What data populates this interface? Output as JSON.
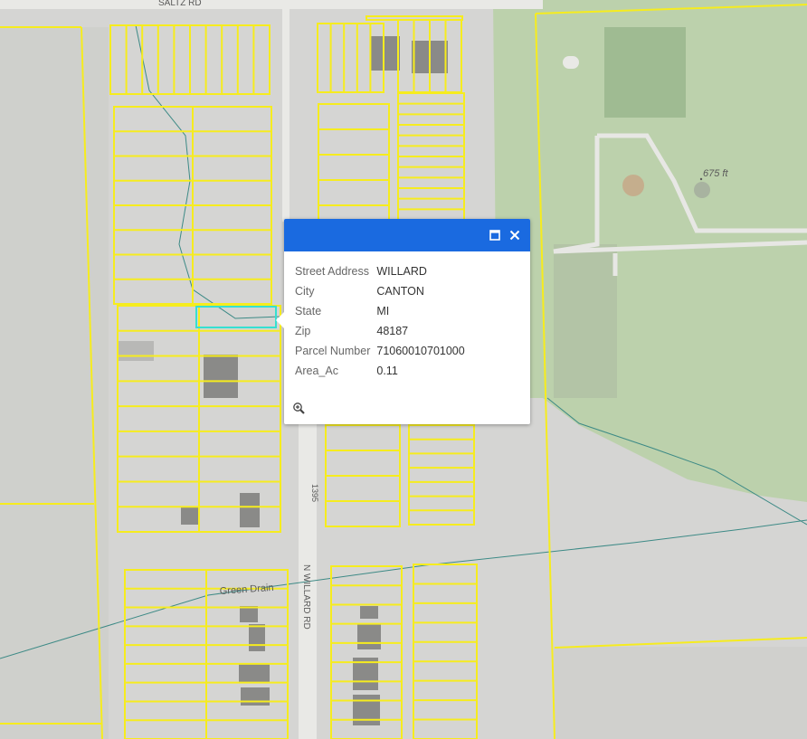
{
  "map": {
    "labels": {
      "saltz_rd": "SALTZ RD",
      "elevation": "675 ft",
      "green_drain": "Green Drain",
      "n_willard_rd": "N WILLARD RD",
      "house_number": "1395"
    },
    "colors": {
      "parcel_outline": "#f6ec1e",
      "selected_parcel": "#36e0d0",
      "park": "#bcd1ac",
      "drain": "#3d8a86"
    }
  },
  "popup": {
    "header_color": "#1a6ae0",
    "icons": {
      "maximize": "maximize-icon",
      "close": "close-icon",
      "zoom_to": "zoom-in-icon"
    },
    "fields": [
      {
        "label": "Street Address",
        "value": "WILLARD"
      },
      {
        "label": "City",
        "value": "CANTON"
      },
      {
        "label": "State",
        "value": "MI"
      },
      {
        "label": "Zip",
        "value": "48187"
      },
      {
        "label": "Parcel Number",
        "value": "71060010701000"
      },
      {
        "label": "Area_Ac",
        "value": "0.11"
      }
    ]
  }
}
